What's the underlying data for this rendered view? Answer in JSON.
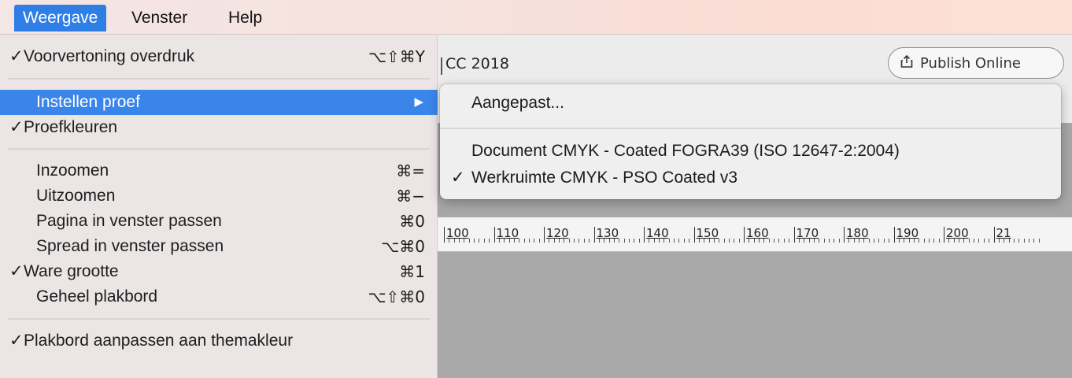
{
  "menubar": {
    "items": [
      {
        "label": "Weergave",
        "active": true
      },
      {
        "label": "Venster",
        "active": false
      },
      {
        "label": "Help",
        "active": false
      }
    ]
  },
  "app": {
    "title_partial": "CC 2018",
    "publish_label": "Publish Online",
    "publish_icon": "share-upload-icon",
    "ruler_labels": [
      "100",
      "110",
      "120",
      "130",
      "140",
      "150",
      "160",
      "170",
      "180",
      "190",
      "200",
      "21"
    ]
  },
  "weergave_menu": {
    "items": [
      {
        "label": "Voorvertoning overdruk",
        "checked": true,
        "shortcut": "⌥⇧⌘Y"
      },
      {
        "label": "Instellen proef",
        "checked": false,
        "has_submenu": true,
        "highlighted": true
      },
      {
        "label": "Proefkleuren",
        "checked": true
      },
      {
        "label": "Inzoomen",
        "checked": false,
        "shortcut": "⌘="
      },
      {
        "label": "Uitzoomen",
        "checked": false,
        "shortcut": "⌘−"
      },
      {
        "label": "Pagina in venster passen",
        "checked": false,
        "shortcut": "⌘0"
      },
      {
        "label": "Spread in venster passen",
        "checked": false,
        "shortcut": "⌥⌘0"
      },
      {
        "label": "Ware grootte",
        "checked": true,
        "shortcut": "⌘1"
      },
      {
        "label": "Geheel plakbord",
        "checked": false,
        "shortcut": "⌥⇧⌘0"
      },
      {
        "label": "Plakbord aanpassen aan themakleur",
        "checked": true
      }
    ],
    "check_glyph": "✓",
    "submenu_arrow": "▶"
  },
  "submenu": {
    "items": [
      {
        "label": "Aangepast...",
        "checked": false
      },
      {
        "label": "Document CMYK - Coated FOGRA39 (ISO 12647-2:2004)",
        "checked": false
      },
      {
        "label": "Werkruimte CMYK - PSO Coated v3",
        "checked": true
      }
    ]
  },
  "colors": {
    "highlight": "#3a85ea",
    "menu_bg": "#ebe6e5",
    "pasteboard": "#a9a9a9"
  }
}
